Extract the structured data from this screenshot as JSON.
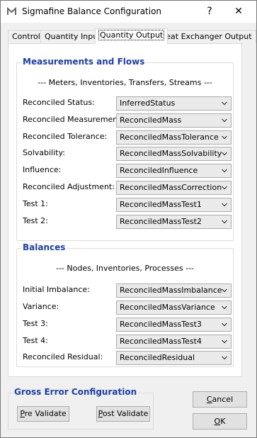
{
  "window": {
    "title": "Sigmafine Balance Configuration",
    "help_label": "?",
    "close_label": "✕"
  },
  "tabs": [
    {
      "label": "Control"
    },
    {
      "label": "Quantity Input"
    },
    {
      "label": "Quantity Output"
    },
    {
      "label": "Heat Exchanger Output"
    }
  ],
  "measurements": {
    "title": "Measurements and Flows",
    "subtitle": "--- Meters, Inventories, Transfers, Streams ---",
    "rows": [
      {
        "label": "Reconciled Status:",
        "value": "InferredStatus"
      },
      {
        "label": "Reconciled Measurement:",
        "value": "ReconciledMass"
      },
      {
        "label": "Reconciled Tolerance:",
        "value": "ReconciledMassTolerance"
      },
      {
        "label": "Solvability:",
        "value": "ReconciledMassSolvability"
      },
      {
        "label": "Influence:",
        "value": "ReconciledInfluence"
      },
      {
        "label": "Reconciled Adjustment:",
        "value": "ReconciledMassCorrection"
      },
      {
        "label": "Test 1:",
        "value": "ReconciledMassTest1"
      },
      {
        "label": "Test 2:",
        "value": "ReconciledMassTest2"
      }
    ]
  },
  "balances": {
    "title": "Balances",
    "subtitle": "--- Nodes, Inventories, Processes ---",
    "rows": [
      {
        "label": "Initial Imbalance:",
        "value": "ReconciledMassImbalance"
      },
      {
        "label": "Variance:",
        "value": "ReconciledMassVariance"
      },
      {
        "label": "Test 3:",
        "value": "ReconciledMassTest3"
      },
      {
        "label": "Test 4:",
        "value": "ReconciledMassTest4"
      },
      {
        "label": "Reconciled Residual:",
        "value": "ReconciledResidual"
      }
    ]
  },
  "gross_error": {
    "title": "Gross Error Configuration",
    "pre_validate_first": "P",
    "pre_validate_rest": "re Validate",
    "post_validate_first": "P",
    "post_validate_rest": "ost Validate"
  },
  "buttons": {
    "cancel_first": "C",
    "cancel_rest": "ancel",
    "ok_first": "O",
    "ok_rest": "K"
  },
  "colors": {
    "group_title": "#1f3fa0",
    "window_bg": "#f0f0f0",
    "panel_bg": "#ffffff"
  }
}
